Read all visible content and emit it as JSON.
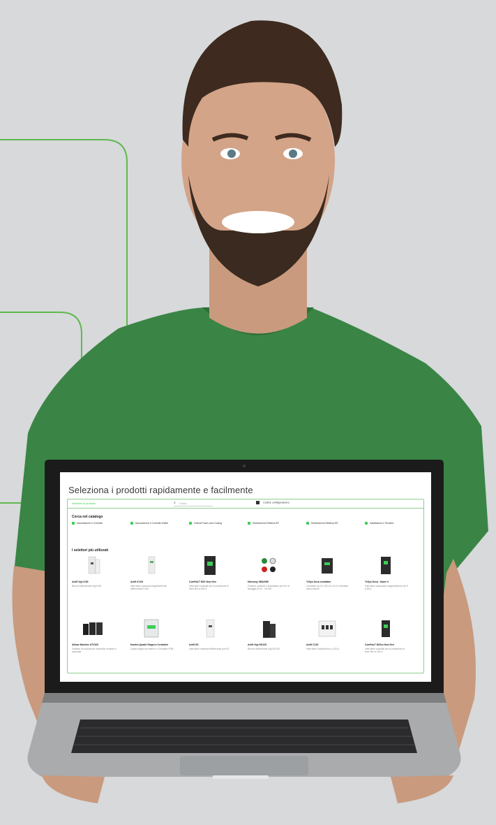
{
  "page_title": "Seleziona i prodotti rapidamente e facilmente",
  "selector": {
    "link": "Selettore di prodotto",
    "search_placeholder": "Cerca",
    "config_label": "Codice configurazione"
  },
  "catalog": {
    "title": "Cerca nel catalogo",
    "categories": [
      {
        "label": "Automazione e Controllo",
        "icon": "automation-icon"
      },
      {
        "label": "Automazione e Controllo Edifici",
        "icon": "building-icon"
      },
      {
        "label": "Critical Power and Cooling",
        "icon": "power-icon"
      },
      {
        "label": "Distribuzione Elettrica BT",
        "icon": "lv-distribution-icon"
      },
      {
        "label": "Distribuzione Elettrica MT",
        "icon": "mv-distribution-icon"
      },
      {
        "label": "Installazioni e Terziario",
        "icon": "installation-icon"
      }
    ]
  },
  "used": {
    "title": "I selettori più utilizzati",
    "products": [
      {
        "name": "Acti9 Vigi iC60",
        "desc": "Blocchi differenziali Vigi iC60"
      },
      {
        "name": "Acti9 iC100",
        "desc": "Interruttori modulari magnetotermici differenziali iC100"
      },
      {
        "name": "ComPacT NSX New Gen",
        "desc": "Interruttori scatolati per la protezione di linee fino a 630 A"
      },
      {
        "name": "Harmony XB4/XB5",
        "desc": "Pulsanti, selettori e segnalatori per fori di fissaggio Ø 22 - 30 mm"
      },
      {
        "name": "TeSys Deca contattori",
        "desc": "Contattori da 9 a 150 A in AC3 e Avviatori salva-motore"
      },
      {
        "name": "TeSys Deca - frame 3",
        "desc": "Interruttori automatici magnetotermici da 9 a 65 A"
      },
      {
        "name": "Altivar Machine ATV320",
        "desc": "Variatori di velocità per macchine semplici e avanzate"
      },
      {
        "name": "Kaedra Quadri Stagni a Centralini",
        "desc": "Quadri stagni da esterno e Centralini IP65"
      },
      {
        "name": "Acti9 iID",
        "desc": "Interruttori modulari differenziali puri iID"
      },
      {
        "name": "Acti9 Vigi NG125",
        "desc": "Blocchi differenziali Vigi NG125"
      },
      {
        "name": "Acti9 C120",
        "desc": "Interruttori modulari fino a 125 A"
      },
      {
        "name": "ComPacT NSXm New Gen",
        "desc": "Interruttori scatolati per la protezione di linee fino a 160 A"
      }
    ]
  },
  "colors": {
    "brand_green": "#3dcd58",
    "shirt_green": "#3a8545",
    "line_green": "#5fb84f",
    "background": "#d7d9db"
  }
}
